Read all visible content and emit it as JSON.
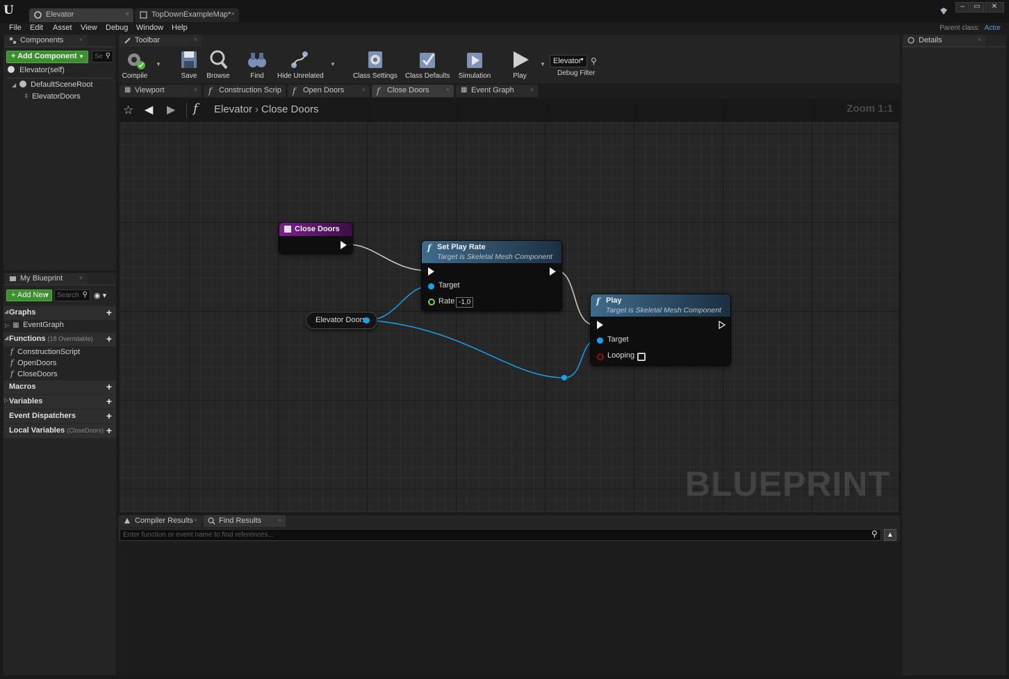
{
  "title_bar": {
    "tabs": [
      {
        "label": "Elevator",
        "active": true
      },
      {
        "label": "TopDownExampleMap*",
        "active": false
      }
    ]
  },
  "menu": {
    "items": [
      "File",
      "Edit",
      "Asset",
      "View",
      "Debug",
      "Window",
      "Help"
    ],
    "parent_class_label": "Parent class:",
    "parent_class_value": "Actor"
  },
  "components_panel": {
    "tab_label": "Components",
    "add_component_label": "+ Add Component",
    "search_placeholder": "Se",
    "self_item": "Elevator(self)",
    "tree": [
      {
        "label": "DefaultSceneRoot"
      },
      {
        "label": "ElevatorDoors"
      }
    ]
  },
  "my_blueprint": {
    "tab_label": "My Blueprint",
    "add_new_label": "+ Add New",
    "search_placeholder": "Search",
    "graphs_label": "Graphs",
    "graphs": [
      "EventGraph"
    ],
    "functions_label": "Functions",
    "functions_sub": "(18 Overridable)",
    "functions": [
      "ConstructionScript",
      "OpenDoors",
      "CloseDoors"
    ],
    "macros_label": "Macros",
    "variables_label": "Variables",
    "dispatchers_label": "Event Dispatchers",
    "local_vars_label": "Local Variables",
    "local_vars_sub": "(CloseDoors)"
  },
  "toolbar": {
    "tab_label": "Toolbar",
    "buttons": [
      "Compile",
      "Save",
      "Browse",
      "Find",
      "Hide Unrelated",
      "Class Settings",
      "Class Defaults",
      "Simulation",
      "Play"
    ],
    "debug_object": "Elevator",
    "debug_filter_label": "Debug Filter"
  },
  "editor_tabs": [
    "Viewport",
    "Construction Scrip",
    "Open Doors",
    "Close Doors",
    "Event Graph"
  ],
  "graph": {
    "breadcrumb_root": "Elevator",
    "breadcrumb_leaf": "Close Doors",
    "zoom": "Zoom 1:1",
    "watermark": "BLUEPRINT",
    "nodes": {
      "entry": {
        "title": "Close Doors"
      },
      "set_play_rate": {
        "title": "Set Play Rate",
        "subtitle": "Target is Skeletal Mesh Component",
        "target_label": "Target",
        "rate_label": "Rate",
        "rate_value": "-1,0"
      },
      "play": {
        "title": "Play",
        "subtitle": "Target is Skeletal Mesh Component",
        "target_label": "Target",
        "looping_label": "Looping",
        "looping_checked": false
      },
      "variable": {
        "title": "Elevator Doors"
      }
    },
    "colors": {
      "exec": "#f0f0f0",
      "object": "#1aa0f0",
      "float": "#7ad14a",
      "bool": "#8e1212",
      "entry_header": "#6a1a78",
      "function_header": "#2e4a64"
    }
  },
  "details_panel": {
    "tab_label": "Details"
  },
  "bottom": {
    "tabs": [
      "Compiler Results",
      "Find Results"
    ],
    "find_placeholder": "Enter function or event name to find references..."
  }
}
